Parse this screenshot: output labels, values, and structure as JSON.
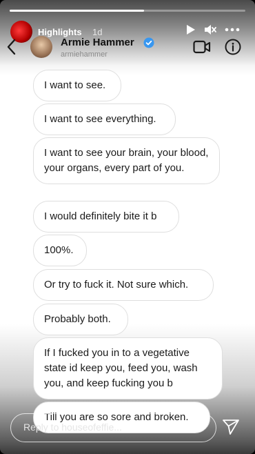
{
  "story": {
    "progress_fraction": 0.57,
    "owner_name": "Highlights",
    "time": "1d"
  },
  "chat": {
    "contact_name": "Armie Hammer",
    "contact_handle": "armiehammer",
    "messages": [
      "I want to see.",
      "I want to see everything.",
      "I want to see your brain, your blood, your organs, every part of you.",
      "I would definitely bite it b",
      "100%.",
      "Or try to fuck it. Not sure which.",
      "Probably both.",
      "If I fucked you in to a vegetative state id keep you, feed you, wash you, and keep fucking you b",
      "Till you are so sore and broken."
    ]
  },
  "reply": {
    "placeholder": "Reply to houseofeffie..."
  },
  "colors": {
    "verified": "#3897f0",
    "bubble_background": "#ffffff",
    "bubble_border": "#dedede"
  },
  "icons": [
    "play-icon",
    "mute-icon",
    "more-icon",
    "back-icon",
    "verified-icon",
    "video-call-icon",
    "info-icon",
    "send-icon"
  ]
}
